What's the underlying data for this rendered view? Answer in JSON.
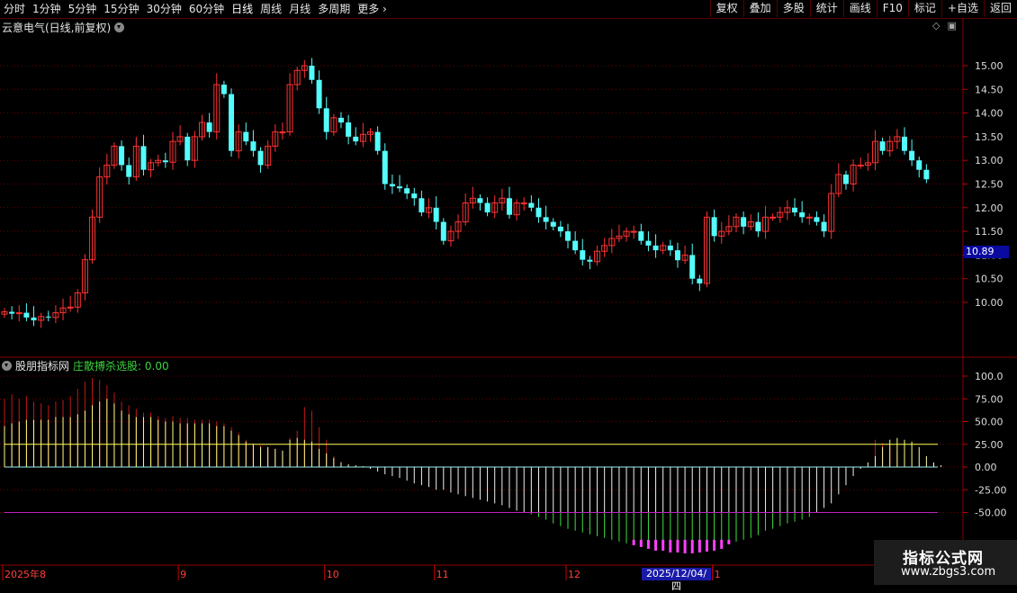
{
  "toolbar": {
    "periods": [
      "分时",
      "1分钟",
      "5分钟",
      "15分钟",
      "30分钟",
      "60分钟",
      "日线",
      "周线",
      "月线",
      "多周期",
      "更多"
    ],
    "active": "日线",
    "right_buttons": [
      "复权",
      "叠加",
      "多股",
      "统计",
      "画线",
      "F10",
      "标记",
      "+自选",
      "返回"
    ]
  },
  "stock": {
    "title": "云意电气(日线,前复权)"
  },
  "indicator": {
    "name": "股朋指标网",
    "formula_label": "庄散搏杀选股: 0.00"
  },
  "price_tag": "10.89",
  "hover_date": "2025/12/04/四",
  "logo": {
    "main": "指标公式网",
    "sub": "www.zbgs3.com"
  },
  "colors": {
    "up": "#ff3232",
    "down": "#54fcfc",
    "yellow_line": "#ffff55",
    "purple_line": "#c020c0",
    "grid": "#6a0000"
  },
  "chart_data": [
    {
      "type": "candlestick",
      "y_ticks": [
        "15.00",
        "14.50",
        "14.00",
        "13.50",
        "13.00",
        "12.50",
        "12.00",
        "11.50",
        "11.00",
        "10.50",
        "10.00"
      ],
      "y_values": [
        15.0,
        14.5,
        14.0,
        13.5,
        13.0,
        12.5,
        12.0,
        11.5,
        11.0,
        10.5,
        10.0
      ],
      "x_labels": [
        {
          "label": "2025年8",
          "index": 0
        },
        {
          "label": "9",
          "index": 24
        },
        {
          "label": "10",
          "index": 44
        },
        {
          "label": "11",
          "index": 59
        },
        {
          "label": "12",
          "index": 77
        },
        {
          "label": "1",
          "index": 97
        }
      ],
      "closes": [
        9.8,
        9.76,
        9.78,
        9.68,
        9.62,
        9.7,
        9.68,
        9.78,
        9.88,
        9.9,
        10.2,
        10.9,
        11.8,
        12.65,
        12.9,
        13.3,
        12.9,
        12.65,
        13.3,
        12.8,
        12.95,
        13.0,
        12.96,
        13.4,
        13.5,
        13.0,
        13.5,
        13.8,
        13.6,
        14.6,
        14.4,
        13.2,
        13.6,
        13.4,
        13.2,
        12.9,
        13.3,
        13.6,
        13.6,
        14.6,
        14.9,
        15.0,
        14.7,
        14.1,
        13.6,
        13.9,
        13.8,
        13.5,
        13.4,
        13.55,
        13.6,
        13.2,
        12.5,
        12.45,
        12.41,
        12.3,
        12.2,
        11.9,
        12.0,
        11.7,
        11.3,
        11.5,
        11.7,
        12.1,
        12.2,
        12.1,
        11.9,
        12.1,
        12.2,
        11.85,
        12.1,
        12.1,
        12.0,
        11.8,
        11.7,
        11.6,
        11.5,
        11.3,
        11.1,
        10.9,
        10.86,
        11.08,
        11.2,
        11.35,
        11.4,
        11.5,
        11.5,
        11.3,
        11.2,
        11.1,
        11.2,
        11.1,
        10.89,
        11.0,
        10.5,
        10.4,
        11.8,
        11.4,
        11.5,
        11.6,
        11.8,
        11.6,
        11.7,
        11.5,
        11.8,
        11.8,
        11.9,
        12.0,
        11.9,
        11.8,
        11.8,
        11.7,
        11.5,
        12.3,
        12.7,
        12.5,
        12.9,
        12.9,
        12.95,
        13.4,
        13.2,
        13.4,
        13.5,
        13.2,
        13.0,
        12.8,
        12.6
      ],
      "visible_closes": 103,
      "high_annotation": null
    },
    {
      "type": "bar",
      "name": "庄散搏杀选股",
      "y_ticks": [
        "100.0",
        "75.00",
        "50.00",
        "25.00",
        "0.00",
        "-25.00",
        "-50.00"
      ],
      "y_values": [
        100,
        75,
        50,
        25,
        0,
        -25,
        -50
      ],
      "ref_lines": [
        25,
        -50
      ],
      "values": [
        45,
        48,
        50,
        52,
        52,
        52,
        52,
        55,
        55,
        55,
        58,
        62,
        68,
        72,
        75,
        70,
        62,
        58,
        55,
        55,
        55,
        52,
        50,
        50,
        48,
        48,
        48,
        48,
        48,
        45,
        45,
        40,
        35,
        28,
        25,
        22,
        22,
        20,
        18,
        30,
        32,
        30,
        28,
        20,
        15,
        10,
        5,
        3,
        2,
        1,
        -2,
        -5,
        -8,
        -10,
        -12,
        -15,
        -18,
        -20,
        -22,
        -25,
        -25,
        -28,
        -30,
        -32,
        -34,
        -36,
        -38,
        -40,
        -42,
        -45,
        -48,
        -50,
        -52,
        -55,
        -58,
        -62,
        -65,
        -68,
        -70,
        -72,
        -74,
        -76,
        -78,
        -80,
        -82,
        -84,
        -86,
        -88,
        -90,
        -92,
        -92,
        -94,
        -94,
        -95,
        -95,
        -94,
        -93,
        -92,
        -90,
        -85,
        -82,
        -80,
        -78,
        -75,
        -70,
        -68,
        -65,
        -62,
        -60,
        -58,
        -55,
        -50,
        -45,
        -40,
        -30,
        -20,
        -10,
        -2,
        5,
        12,
        22,
        30,
        32,
        30,
        28,
        22,
        12,
        5,
        2
      ],
      "red_values": [
        75,
        80,
        75,
        78,
        72,
        70,
        68,
        72,
        74,
        78,
        86,
        94,
        98,
        96,
        90,
        82,
        72,
        68,
        64,
        60,
        60,
        56,
        54,
        56,
        54,
        54,
        52,
        52,
        52,
        50,
        48,
        44,
        38,
        30,
        26,
        24,
        22,
        20,
        18,
        32,
        40,
        66,
        62,
        44,
        30,
        12,
        6
      ],
      "red_count": 47
    }
  ]
}
